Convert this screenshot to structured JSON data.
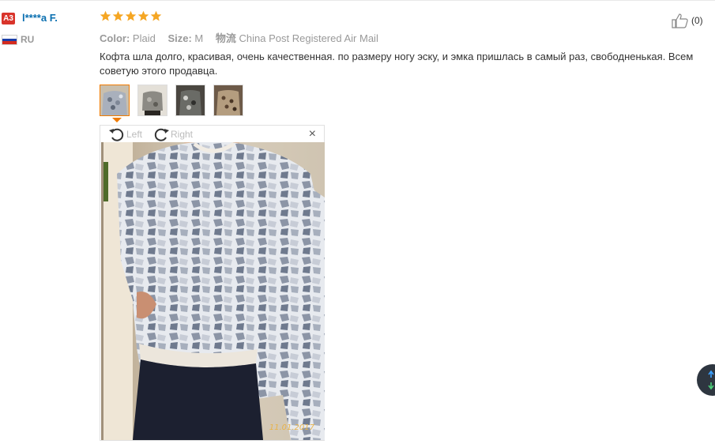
{
  "user": {
    "level_badge": "A3",
    "name": "l****a F.",
    "country": "RU"
  },
  "review": {
    "rating": 5,
    "color_label": "Color:",
    "color_value": "Plaid",
    "size_label": "Size:",
    "size_value": "M",
    "shipping_label": "物流",
    "shipping_value": "China Post Registered Air Mail",
    "text": "Кофта шла долго, красивая, очень качественная. по размеру ногу эску, и эмка пришлась в самый раз, свободненькая. Всем советую этого продавца.",
    "likes": "(0)"
  },
  "viewer": {
    "rotate_left": "Left",
    "rotate_right": "Right",
    "close_symbol": "×",
    "photo_date": "11.01.2017"
  },
  "icons": {
    "star": "star-icon",
    "like": "thumbs-up-icon",
    "rotate_left": "rotate-left-icon",
    "rotate_right": "rotate-right-icon",
    "close": "close-icon",
    "scroll_up": "arrow-up-icon",
    "scroll_down": "arrow-down-icon"
  },
  "colors": {
    "badge": "#d9342b",
    "username": "#0a6fb0",
    "star": "#f5a623",
    "active_thumb": "#f07b00",
    "date_stamp": "#e8b34a"
  }
}
